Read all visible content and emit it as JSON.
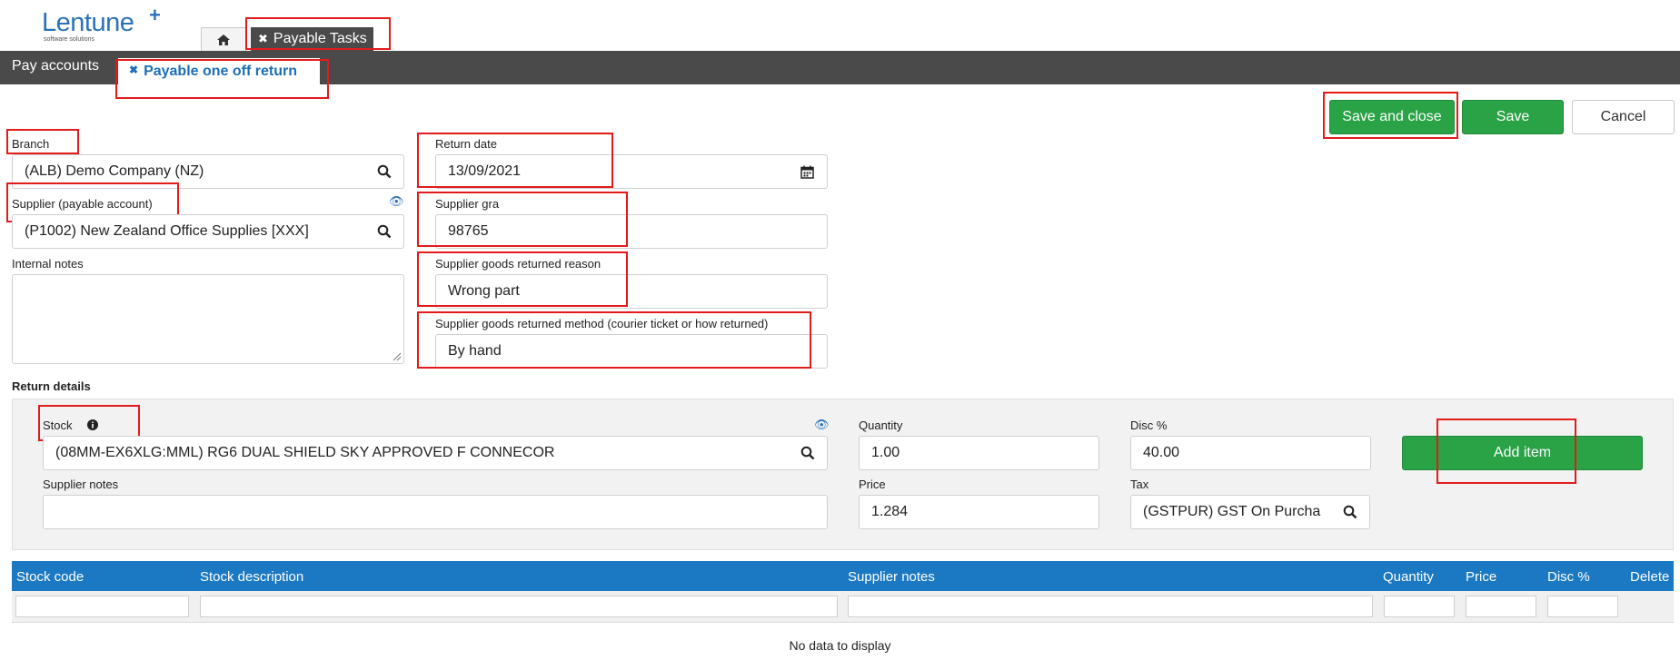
{
  "header": {
    "logo_text": "Lentune",
    "logo_sub": "software solutions",
    "task_tab_label": "Payable Tasks"
  },
  "subtabs": {
    "pay_accounts": "Pay accounts",
    "active": "Payable one off return"
  },
  "actions": {
    "save_close": "Save and close",
    "save": "Save",
    "cancel": "Cancel"
  },
  "form": {
    "branch_label": "Branch",
    "branch_value": "(ALB) Demo Company (NZ)",
    "supplier_label": "Supplier (payable account)",
    "supplier_value": "(P1002) New Zealand Office Supplies [XXX]",
    "internal_notes_label": "Internal notes",
    "internal_notes_value": "",
    "return_date_label": "Return date",
    "return_date_value": "13/09/2021",
    "supplier_gra_label": "Supplier gra",
    "supplier_gra_value": "98765",
    "reason_label": "Supplier goods returned reason",
    "reason_value": "Wrong part",
    "method_label": "Supplier goods returned method (courier ticket or how returned)",
    "method_value": "By hand"
  },
  "return_details": {
    "title": "Return details",
    "stock_label": "Stock",
    "stock_value": "(08MM-EX6XLG:MML) RG6 DUAL SHIELD SKY APPROVED F CONNECOR",
    "supplier_notes_label": "Supplier notes",
    "supplier_notes_value": "",
    "quantity_label": "Quantity",
    "quantity_value": "1.00",
    "price_label": "Price",
    "price_value": "1.284",
    "disc_label": "Disc %",
    "disc_value": "40.00",
    "tax_label": "Tax",
    "tax_value": "(GSTPUR) GST On Purcha",
    "add_item": "Add item"
  },
  "table": {
    "columns": [
      "Stock code",
      "Stock description",
      "Supplier notes",
      "Quantity",
      "Price",
      "Disc %",
      "Delete"
    ],
    "empty_text": "No data to display"
  },
  "colors": {
    "brand_blue": "#2a72b8",
    "header_dark": "#4a4a4a",
    "table_blue": "#1b78c2",
    "green": "#2aa246",
    "highlight_red": "#e31b1b"
  },
  "icons": [
    "home-icon",
    "close-icon",
    "search-icon",
    "calendar-icon",
    "eye-icon",
    "info-icon",
    "resize-icon"
  ]
}
